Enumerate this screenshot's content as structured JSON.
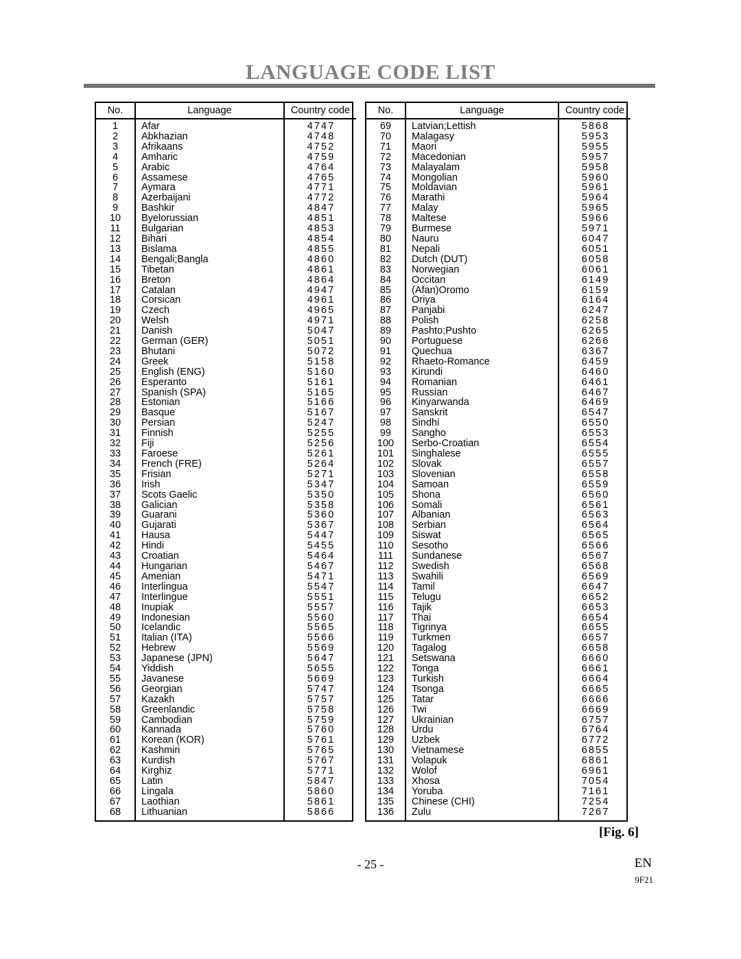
{
  "page": {
    "title": "LANGUAGE CODE LIST",
    "figure_label": "[Fig. 6]",
    "page_number": "- 25 -",
    "language_mark": "EN",
    "doc_code": "9F21"
  },
  "table": {
    "headers": {
      "no": "No.",
      "language": "Language",
      "country_code": "Country code"
    },
    "left_rows": [
      {
        "no": "1",
        "language": "Afar",
        "code": "4747"
      },
      {
        "no": "2",
        "language": "Abkhazian",
        "code": "4748"
      },
      {
        "no": "3",
        "language": "Afrikaans",
        "code": "4752"
      },
      {
        "no": "4",
        "language": "Amharic",
        "code": "4759"
      },
      {
        "no": "5",
        "language": "Arabic",
        "code": "4764"
      },
      {
        "no": "6",
        "language": "Assamese",
        "code": "4765"
      },
      {
        "no": "7",
        "language": "Aymara",
        "code": "4771"
      },
      {
        "no": "8",
        "language": "Azerbaijani",
        "code": "4772"
      },
      {
        "no": "9",
        "language": "Bashkir",
        "code": "4847"
      },
      {
        "no": "10",
        "language": "Byelorussian",
        "code": "4851"
      },
      {
        "no": "11",
        "language": "Bulgarian",
        "code": "4853"
      },
      {
        "no": "12",
        "language": "Bihari",
        "code": "4854"
      },
      {
        "no": "13",
        "language": "Bislama",
        "code": "4855"
      },
      {
        "no": "14",
        "language": "Bengali;Bangla",
        "code": "4860"
      },
      {
        "no": "15",
        "language": "Tibetan",
        "code": "4861"
      },
      {
        "no": "16",
        "language": "Breton",
        "code": "4864"
      },
      {
        "no": "17",
        "language": "Catalan",
        "code": "4947"
      },
      {
        "no": "18",
        "language": "Corsican",
        "code": "4961"
      },
      {
        "no": "19",
        "language": "Czech",
        "code": "4965"
      },
      {
        "no": "20",
        "language": "Welsh",
        "code": "4971"
      },
      {
        "no": "21",
        "language": "Danish",
        "code": "5047"
      },
      {
        "no": "22",
        "language": "German (GER)",
        "code": "5051"
      },
      {
        "no": "23",
        "language": "Bhutani",
        "code": "5072"
      },
      {
        "no": "24",
        "language": "Greek",
        "code": "5158"
      },
      {
        "no": "25",
        "language": "English (ENG)",
        "code": "5160"
      },
      {
        "no": "26",
        "language": "Esperanto",
        "code": "5161"
      },
      {
        "no": "27",
        "language": "Spanish (SPA)",
        "code": "5165"
      },
      {
        "no": "28",
        "language": "Estonian",
        "code": "5166"
      },
      {
        "no": "29",
        "language": "Basque",
        "code": "5167"
      },
      {
        "no": "30",
        "language": "Persian",
        "code": "5247"
      },
      {
        "no": "31",
        "language": "Finnish",
        "code": "5255"
      },
      {
        "no": "32",
        "language": "Fiji",
        "code": "5256"
      },
      {
        "no": "33",
        "language": "Faroese",
        "code": "5261"
      },
      {
        "no": "34",
        "language": "French (FRE)",
        "code": "5264"
      },
      {
        "no": "35",
        "language": "Frisian",
        "code": "5271"
      },
      {
        "no": "36",
        "language": "Irish",
        "code": "5347"
      },
      {
        "no": "37",
        "language": "Scots Gaelic",
        "code": "5350"
      },
      {
        "no": "38",
        "language": "Galician",
        "code": "5358"
      },
      {
        "no": "39",
        "language": "Guarani",
        "code": "5360"
      },
      {
        "no": "40",
        "language": "Gujarati",
        "code": "5367"
      },
      {
        "no": "41",
        "language": "Hausa",
        "code": "5447"
      },
      {
        "no": "42",
        "language": "Hindi",
        "code": "5455"
      },
      {
        "no": "43",
        "language": "Croatian",
        "code": "5464"
      },
      {
        "no": "44",
        "language": "Hungarian",
        "code": "5467"
      },
      {
        "no": "45",
        "language": "Amenian",
        "code": "5471"
      },
      {
        "no": "46",
        "language": "Interlingua",
        "code": "5547"
      },
      {
        "no": "47",
        "language": "Interlingue",
        "code": "5551"
      },
      {
        "no": "48",
        "language": "Inupiak",
        "code": "5557"
      },
      {
        "no": "49",
        "language": "Indonesian",
        "code": "5560"
      },
      {
        "no": "50",
        "language": "Icelandic",
        "code": "5565"
      },
      {
        "no": "51",
        "language": "Italian (ITA)",
        "code": "5566"
      },
      {
        "no": "52",
        "language": "Hebrew",
        "code": "5569"
      },
      {
        "no": "53",
        "language": "Japanese (JPN)",
        "code": "5647"
      },
      {
        "no": "54",
        "language": "Yiddish",
        "code": "5655"
      },
      {
        "no": "55",
        "language": "Javanese",
        "code": "5669"
      },
      {
        "no": "56",
        "language": "Georgian",
        "code": "5747"
      },
      {
        "no": "57",
        "language": "Kazakh",
        "code": "5757"
      },
      {
        "no": "58",
        "language": "Greenlandic",
        "code": "5758"
      },
      {
        "no": "59",
        "language": "Cambodian",
        "code": "5759"
      },
      {
        "no": "60",
        "language": "Kannada",
        "code": "5760"
      },
      {
        "no": "61",
        "language": "Korean (KOR)",
        "code": "5761"
      },
      {
        "no": "62",
        "language": "Kashmiri",
        "code": "5765"
      },
      {
        "no": "63",
        "language": "Kurdish",
        "code": "5767"
      },
      {
        "no": "64",
        "language": "Kirghiz",
        "code": "5771"
      },
      {
        "no": "65",
        "language": "Latin",
        "code": "5847"
      },
      {
        "no": "66",
        "language": "Lingala",
        "code": "5860"
      },
      {
        "no": "67",
        "language": "Laothian",
        "code": "5861"
      },
      {
        "no": "68",
        "language": "Lithuanian",
        "code": "5866"
      }
    ],
    "right_rows": [
      {
        "no": "69",
        "language": "Latvian;Lettish",
        "code": "5868"
      },
      {
        "no": "70",
        "language": "Malagasy",
        "code": "5953"
      },
      {
        "no": "71",
        "language": "Maori",
        "code": "5955"
      },
      {
        "no": "72",
        "language": "Macedonian",
        "code": "5957"
      },
      {
        "no": "73",
        "language": "Malayalam",
        "code": "5958"
      },
      {
        "no": "74",
        "language": "Mongolian",
        "code": "5960"
      },
      {
        "no": "75",
        "language": "Moldavian",
        "code": "5961"
      },
      {
        "no": "76",
        "language": "Marathi",
        "code": "5964"
      },
      {
        "no": "77",
        "language": "Malay",
        "code": "5965"
      },
      {
        "no": "78",
        "language": "Maltese",
        "code": "5966"
      },
      {
        "no": "79",
        "language": "Burmese",
        "code": "5971"
      },
      {
        "no": "80",
        "language": "Nauru",
        "code": "6047"
      },
      {
        "no": "81",
        "language": "Nepali",
        "code": "6051"
      },
      {
        "no": "82",
        "language": "Dutch (DUT)",
        "code": "6058"
      },
      {
        "no": "83",
        "language": "Norwegian",
        "code": "6061"
      },
      {
        "no": "84",
        "language": "Occitan",
        "code": "6149"
      },
      {
        "no": "85",
        "language": "(Afan)Oromo",
        "code": "6159"
      },
      {
        "no": "86",
        "language": "Oriya",
        "code": "6164"
      },
      {
        "no": "87",
        "language": "Panjabi",
        "code": "6247"
      },
      {
        "no": "88",
        "language": "Polish",
        "code": "6258"
      },
      {
        "no": "89",
        "language": "Pashto;Pushto",
        "code": "6265"
      },
      {
        "no": "90",
        "language": "Portuguese",
        "code": "6266"
      },
      {
        "no": "91",
        "language": "Quechua",
        "code": "6367"
      },
      {
        "no": "92",
        "language": "Rhaeto-Romance",
        "code": "6459"
      },
      {
        "no": "93",
        "language": "Kirundi",
        "code": "6460"
      },
      {
        "no": "94",
        "language": "Romanian",
        "code": "6461"
      },
      {
        "no": "95",
        "language": "Russian",
        "code": "6467"
      },
      {
        "no": "96",
        "language": "Kinyarwanda",
        "code": "6469"
      },
      {
        "no": "97",
        "language": "Sanskrit",
        "code": "6547"
      },
      {
        "no": "98",
        "language": "Sindhi",
        "code": "6550"
      },
      {
        "no": "99",
        "language": "Sangho",
        "code": "6553"
      },
      {
        "no": "100",
        "language": "Serbo-Croatian",
        "code": "6554"
      },
      {
        "no": "101",
        "language": "Singhalese",
        "code": "6555"
      },
      {
        "no": "102",
        "language": "Slovak",
        "code": "6557"
      },
      {
        "no": "103",
        "language": "Slovenian",
        "code": "6558"
      },
      {
        "no": "104",
        "language": "Samoan",
        "code": "6559"
      },
      {
        "no": "105",
        "language": "Shona",
        "code": "6560"
      },
      {
        "no": "106",
        "language": "Somali",
        "code": "6561"
      },
      {
        "no": "107",
        "language": "Albanian",
        "code": "6563"
      },
      {
        "no": "108",
        "language": "Serbian",
        "code": "6564"
      },
      {
        "no": "109",
        "language": "Siswat",
        "code": "6565"
      },
      {
        "no": "110",
        "language": "Sesotho",
        "code": "6566"
      },
      {
        "no": "111",
        "language": "Sundanese",
        "code": "6567"
      },
      {
        "no": "112",
        "language": "Swedish",
        "code": "6568"
      },
      {
        "no": "113",
        "language": "Swahili",
        "code": "6569"
      },
      {
        "no": "114",
        "language": "Tamil",
        "code": "6647"
      },
      {
        "no": "115",
        "language": "Telugu",
        "code": "6652"
      },
      {
        "no": "116",
        "language": "Tajik",
        "code": "6653"
      },
      {
        "no": "117",
        "language": "Thai",
        "code": "6654"
      },
      {
        "no": "118",
        "language": "Tigrinya",
        "code": "6655"
      },
      {
        "no": "119",
        "language": "Turkmen",
        "code": "6657"
      },
      {
        "no": "120",
        "language": "Tagalog",
        "code": "6658"
      },
      {
        "no": "121",
        "language": "Setswana",
        "code": "6660"
      },
      {
        "no": "122",
        "language": "Tonga",
        "code": "6661"
      },
      {
        "no": "123",
        "language": "Turkish",
        "code": "6664"
      },
      {
        "no": "124",
        "language": "Tsonga",
        "code": "6665"
      },
      {
        "no": "125",
        "language": "Tatar",
        "code": "6666"
      },
      {
        "no": "126",
        "language": "Twi",
        "code": "6669"
      },
      {
        "no": "127",
        "language": "Ukrainian",
        "code": "6757"
      },
      {
        "no": "128",
        "language": "Urdu",
        "code": "6764"
      },
      {
        "no": "129",
        "language": "Uzbek",
        "code": "6772"
      },
      {
        "no": "130",
        "language": "Vietnamese",
        "code": "6855"
      },
      {
        "no": "131",
        "language": "Volapuk",
        "code": "6861"
      },
      {
        "no": "132",
        "language": "Wolof",
        "code": "6961"
      },
      {
        "no": "133",
        "language": "Xhosa",
        "code": "7054"
      },
      {
        "no": "134",
        "language": "Yoruba",
        "code": "7161"
      },
      {
        "no": "135",
        "language": "Chinese (CHI)",
        "code": "7254"
      },
      {
        "no": "136",
        "language": "Zulu",
        "code": "7267"
      }
    ]
  },
  "colors": {
    "title": "#808080",
    "rule": "#737373",
    "text": "#000000",
    "background": "#ffffff"
  }
}
